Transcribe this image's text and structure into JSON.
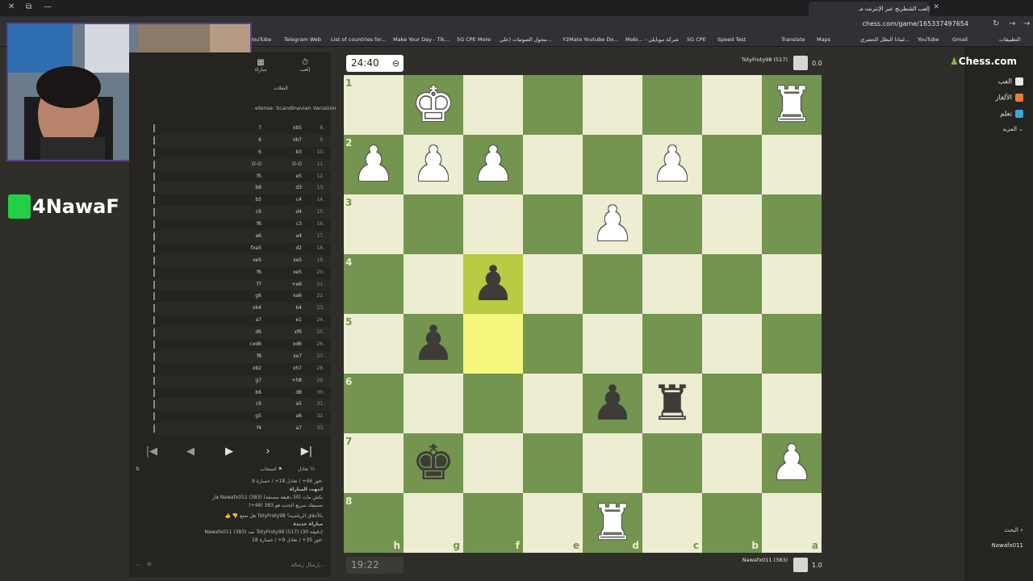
{
  "browser": {
    "tab_title": "إلعب الشطرنج عبر الإنترنت مـ",
    "url": "chess.com/game/165337497654",
    "bookmarks": [
      "YouTube",
      "Telegram Web",
      "List of countries for...",
      "Make Your Day - Tik...",
      "5G CPE More",
      "محول الصوتيات (على...",
      "Y2Mate Youtube Do...",
      "Mobi... - شركة موبايلي",
      "5G CPE",
      "Speed Test",
      "Translate",
      "Maps",
      "لماذا البطل الحصري...",
      "YouTube",
      "Gmail",
      "التطبيقات"
    ]
  },
  "stream": {
    "logo_text": "4NawaF"
  },
  "panel": {
    "tab_play": "إلعب",
    "tab_game": "مباراة",
    "moves_tab": "النقلات",
    "opening": "efense: Scandinavian Variation",
    "moves": [
      {
        "n": "8.",
        "w": "xb5",
        "b": "7"
      },
      {
        "n": "9.",
        "w": "xb7",
        "b": "6"
      },
      {
        "n": "10.",
        "w": "b3",
        "b": "6"
      },
      {
        "n": "11.",
        "w": "O-O",
        "b": "O-O"
      },
      {
        "n": "12.",
        "w": "e5",
        "b": "f5"
      },
      {
        "n": "13.",
        "w": "d3",
        "b": "b8"
      },
      {
        "n": "14.",
        "w": "c4",
        "b": "b5"
      },
      {
        "n": "15.",
        "w": "d4",
        "b": "c6"
      },
      {
        "n": "16.",
        "w": "c3",
        "b": "f6"
      },
      {
        "n": "17.",
        "w": "a4",
        "b": "a6"
      },
      {
        "n": "18.",
        "w": "d2",
        "b": "fxa5"
      },
      {
        "n": "19.",
        "w": "xe5",
        "b": "xe5"
      },
      {
        "n": "20.",
        "w": "xe5",
        "b": "f6"
      },
      {
        "n": "21.",
        "w": "+e6",
        "b": "f7"
      },
      {
        "n": "22.",
        "w": "xa6",
        "b": "g6"
      },
      {
        "n": "23.",
        "w": "b4",
        "b": "xb4"
      },
      {
        "n": "24.",
        "w": "e1",
        "b": "a7"
      },
      {
        "n": "25.",
        "w": "xf6",
        "b": "d6"
      },
      {
        "n": "26.",
        "w": "xd6",
        "b": "cxd6"
      },
      {
        "n": "27.",
        "w": "xe7",
        "b": "f8"
      },
      {
        "n": "28.",
        "w": "xh7",
        "b": "xb2"
      },
      {
        "n": "29.",
        "w": "+h8",
        "b": "g7"
      },
      {
        "n": "30.",
        "w": "d8",
        "b": "b6"
      },
      {
        "n": "31.",
        "w": "a5",
        "b": "c6"
      },
      {
        "n": "32.",
        "w": "a6",
        "b": "g5"
      },
      {
        "n": "33.",
        "w": "a7",
        "b": "f4"
      }
    ],
    "draw_label": "تعادل",
    "resign_label": "انسحاب",
    "stats_line": "فوز 46+ / تعادل 18+ / خسارة 9-",
    "game_over": "انتهت المباراة",
    "result_line": "فاز Nawafx011 (383) بكش مات (30 دقيقة مصنفة)",
    "rating_line": "تصنيفك سريع الجديد هو 383 (46+)",
    "sportsmanship": "هل تمتع TotyFroty98 بالأخلاق الرياضية؟",
    "new_game": "مباراة جديدة",
    "matchup": "Nawafx011 (383) ضد TotyFroty98 (517) (30 دقيقة)",
    "stats_line2": "فوز 35+ / تعادل 9+ / خسارة 18-",
    "message_placeholder": "إرسال رسالة..."
  },
  "game": {
    "clock_top": "24:40",
    "clock_bottom": "19:22",
    "player_top": "TotyFroty98 (517)",
    "player_bottom": "Nawafx011 (383)",
    "score_top": "0.0",
    "score_bottom": "1.0",
    "ranks": [
      "1",
      "2",
      "3",
      "4",
      "5",
      "6",
      "7",
      "8"
    ],
    "files": [
      "h",
      "g",
      "f",
      "e",
      "d",
      "c",
      "b",
      "a"
    ]
  },
  "sidebar": {
    "logo": "Chess.com",
    "items": [
      "العب",
      "الألغاز",
      "تعلم",
      "المزيد"
    ],
    "search": "البحث",
    "user": "Nawafx011"
  },
  "colors": {
    "board_light": "#ecedd1",
    "board_dark": "#73954f",
    "highlight": "#f5f67b",
    "accent_green": "#81b64c"
  }
}
